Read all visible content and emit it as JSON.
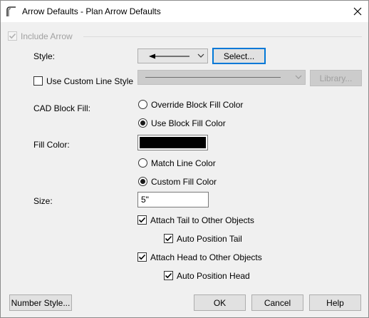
{
  "window": {
    "title": "Arrow Defaults - Plan Arrow Defaults"
  },
  "include_arrow": {
    "label": "Include Arrow",
    "checked": true,
    "enabled": false
  },
  "style": {
    "label": "Style:",
    "select_label": "Select..."
  },
  "custom_line": {
    "label": "Use Custom Line Style",
    "checked": false,
    "library_label": "Library..."
  },
  "cad_fill": {
    "label": "CAD Block Fill:",
    "options": [
      "Override Block Fill Color",
      "Use Block Fill Color"
    ],
    "selected": "Use Block Fill Color"
  },
  "fill_color": {
    "label": "Fill Color:",
    "color": "#000000",
    "options": [
      "Match Line Color",
      "Custom Fill Color"
    ],
    "selected": "Custom Fill Color"
  },
  "size": {
    "label": "Size:",
    "value": "5\""
  },
  "attach": {
    "tail_label": "Attach Tail to Other Objects",
    "tail_checked": true,
    "auto_tail_label": "Auto Position Tail",
    "auto_tail_checked": true,
    "head_label": "Attach Head to Other Objects",
    "head_checked": true,
    "auto_head_label": "Auto Position Head",
    "auto_head_checked": true
  },
  "buttons": {
    "number_style": "Number Style...",
    "ok": "OK",
    "cancel": "Cancel",
    "help": "Help"
  }
}
